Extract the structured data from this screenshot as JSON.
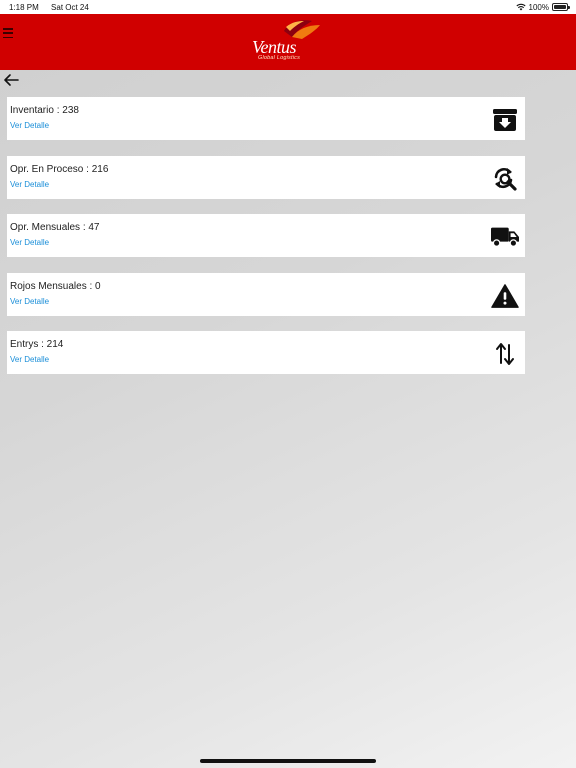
{
  "status_bar": {
    "time": "1:18 PM",
    "date": "Sat Oct 24",
    "battery": "100%"
  },
  "header": {
    "menu_icon": "hamburger-icon",
    "logo_text": "Ventus",
    "logo_subtitle": "Global Logistics",
    "brand_color": "#d00000"
  },
  "nav": {
    "back_icon": "back-arrow-icon"
  },
  "cards": [
    {
      "title": "Inventario : 238",
      "link": "Ver Detalle",
      "icon": "archive-download-icon"
    },
    {
      "title": "Opr. En Proceso : 216",
      "link": "Ver Detalle",
      "icon": "refresh-search-icon"
    },
    {
      "title": "Opr. Mensuales : 47",
      "link": "Ver Detalle",
      "icon": "truck-icon"
    },
    {
      "title": "Rojos Mensuales : 0",
      "link": "Ver Detalle",
      "icon": "warning-icon"
    },
    {
      "title": "Entrys : 214",
      "link": "Ver Detalle",
      "icon": "swap-vertical-icon"
    }
  ],
  "colors": {
    "link": "#1a8ed8",
    "card_bg": "#ffffff",
    "header_bg": "#d00000"
  }
}
